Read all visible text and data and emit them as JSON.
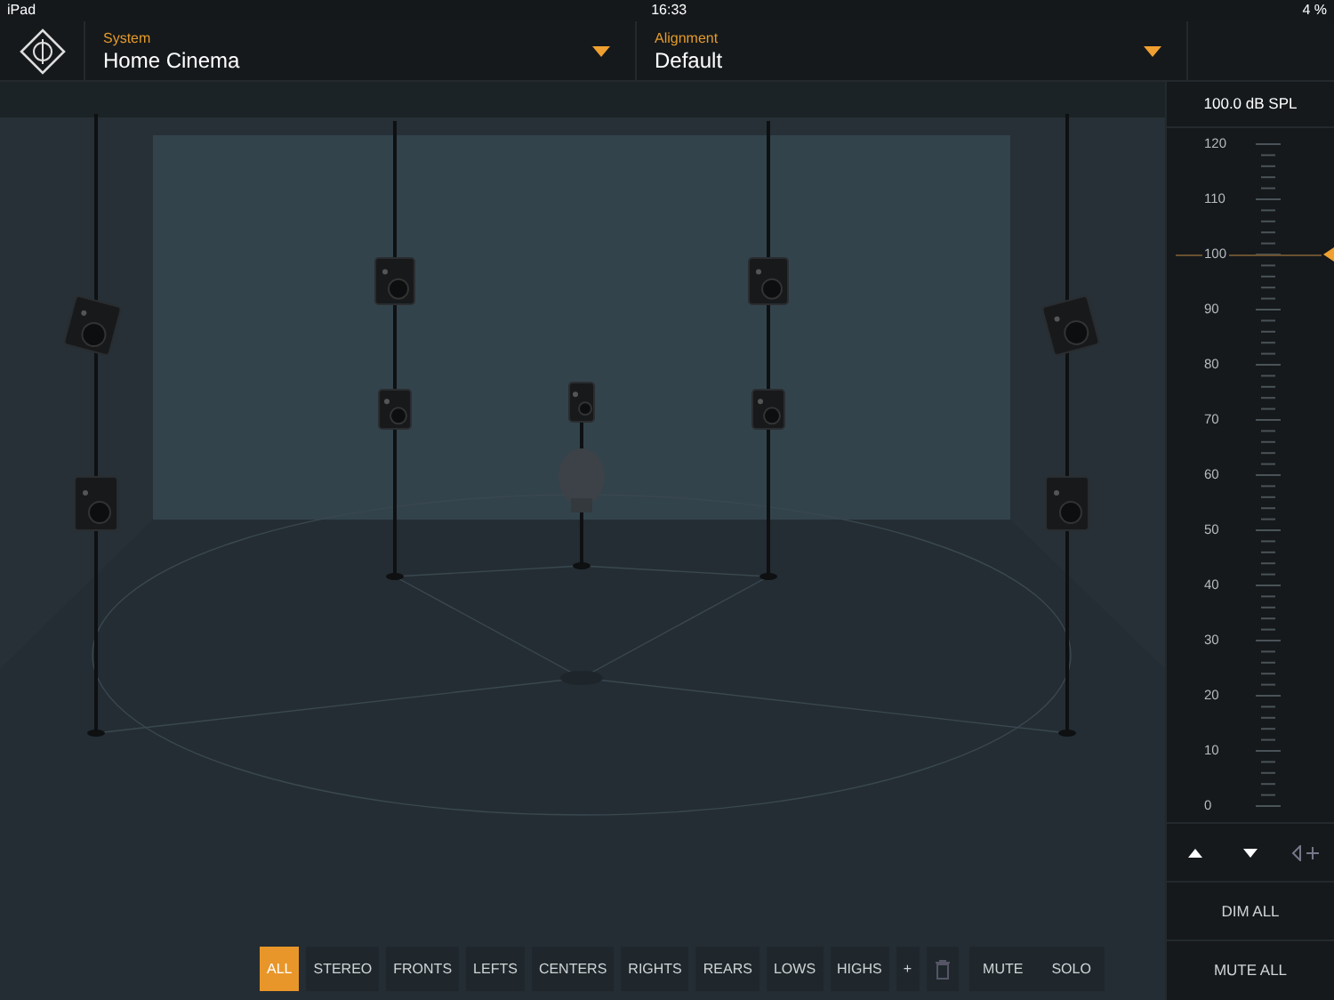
{
  "status_bar": {
    "device": "iPad",
    "time": "16:33",
    "battery": "4 %"
  },
  "selectors": [
    {
      "label": "System",
      "value": "Home Cinema"
    },
    {
      "label": "Alignment",
      "value": "Default"
    }
  ],
  "meter": {
    "reading": "100.0 dB SPL",
    "level": 0.8333,
    "scale": [
      "120",
      "110",
      "100",
      "90",
      "80",
      "70",
      "60",
      "50",
      "40",
      "30",
      "20",
      "10",
      "0"
    ]
  },
  "panel_buttons": [
    "DIM ALL",
    "MUTE ALL"
  ],
  "filters": [
    {
      "kind": "text",
      "label": "ALL",
      "selected": true
    },
    {
      "kind": "text",
      "label": "STEREO",
      "selected": false
    },
    {
      "kind": "text",
      "label": "FRONTS",
      "selected": false
    },
    {
      "kind": "text",
      "label": "LEFTS",
      "selected": false
    },
    {
      "kind": "text",
      "label": "CENTERS",
      "selected": false
    },
    {
      "kind": "text",
      "label": "RIGHTS",
      "selected": false
    },
    {
      "kind": "text",
      "label": "REARS",
      "selected": false
    },
    {
      "kind": "text",
      "label": "LOWS",
      "selected": false
    },
    {
      "kind": "text",
      "label": "HIGHS",
      "selected": false
    },
    {
      "kind": "text",
      "label": "+",
      "selected": false
    },
    {
      "kind": "trash",
      "selected": false
    }
  ],
  "actions": [
    "MUTE",
    "SOLO"
  ]
}
